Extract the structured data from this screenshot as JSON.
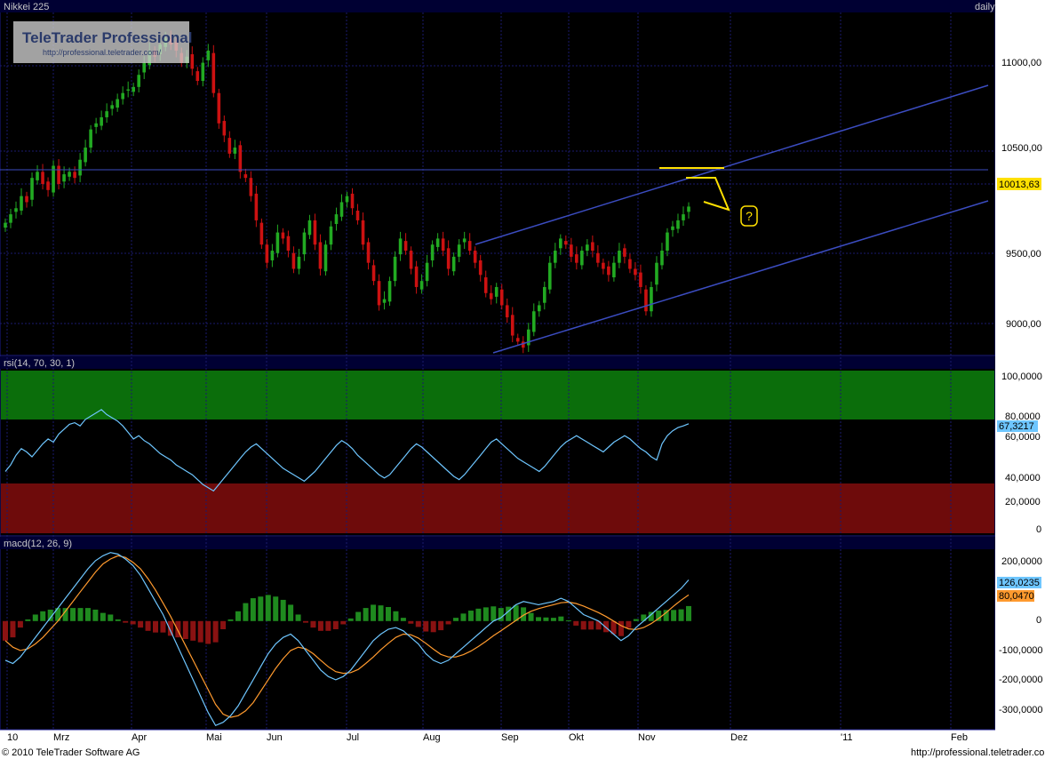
{
  "header": {
    "symbol": "Nikkei 225",
    "interval": "daily"
  },
  "watermark": {
    "brand": "TeleTrader Professional",
    "url": "http://professional.teletrader.com/"
  },
  "months": [
    "10",
    "Mrz",
    "Apr",
    "Mai",
    "Jun",
    "Jul",
    "Aug",
    "Sep",
    "Okt",
    "Nov",
    "Dez",
    "'11",
    "Feb"
  ],
  "footer": {
    "copyright": "© 2010 TeleTrader Software AG",
    "url": "http://professional.teletrader.com/"
  },
  "colors": {
    "background": "#000000",
    "pane_border": "#1a1a8c",
    "grid": "#1a1a6e",
    "candle_up": "#22aa22",
    "candle_down": "#cc1111",
    "channel": "#3b4cc0",
    "annotation": "#ffe000",
    "rsi_line": "#6ec6ff",
    "rsi_overbought": "#0b6e0b",
    "rsi_oversold": "#6e0b0b",
    "macd_line": "#6ec6ff",
    "macd_signal": "#ff9a2e",
    "hist_pos": "#1f8a1f",
    "hist_neg": "#8a1212"
  },
  "chart_data": [
    {
      "type": "candlestick",
      "title": "Nikkei 225",
      "ylim": [
        8800,
        11600
      ],
      "yticks": [
        "11000,00",
        "10500,00",
        "10013,63",
        "9500,00",
        "9000,00"
      ],
      "last_value": "10013,63",
      "x_months": [
        "10",
        "Mrz",
        "Apr",
        "Mai",
        "Jun",
        "Jul",
        "Aug",
        "Sep",
        "Okt",
        "Nov",
        "Dez",
        "'11",
        "Feb"
      ],
      "close": [
        9880,
        9950,
        10000,
        10100,
        10050,
        10250,
        10300,
        10200,
        10150,
        10350,
        10200,
        10280,
        10300,
        10250,
        10400,
        10500,
        10650,
        10700,
        10750,
        10800,
        10850,
        10900,
        10950,
        10980,
        11000,
        11100,
        11200,
        11300,
        11250,
        11350,
        11400,
        11350,
        11300,
        11200,
        11250,
        11150,
        11050,
        11200,
        11300,
        10950,
        10700,
        10600,
        10450,
        10500,
        10300,
        10250,
        10100,
        9900,
        9700,
        9550,
        9650,
        9800,
        9750,
        9650,
        9500,
        9600,
        9800,
        9900,
        9700,
        9500,
        9700,
        9850,
        9950,
        10050,
        10100,
        10000,
        9900,
        9700,
        9550,
        9400,
        9200,
        9250,
        9400,
        9600,
        9750,
        9650,
        9500,
        9350,
        9400,
        9550,
        9700,
        9750,
        9650,
        9500,
        9600,
        9700,
        9750,
        9650,
        9550,
        9450,
        9300,
        9250,
        9350,
        9200,
        9100,
        8950,
        8900,
        8850,
        9000,
        9150,
        9200,
        9350,
        9550,
        9650,
        9750,
        9700,
        9600,
        9550,
        9650,
        9700,
        9650,
        9550,
        9500,
        9450,
        9550,
        9650,
        9600,
        9500,
        9450,
        9350,
        9150,
        9350,
        9550,
        9650,
        9800,
        9850,
        9900,
        9950,
        10013.63
      ],
      "annotations": [
        "?"
      ]
    },
    {
      "type": "line",
      "title": "rsi(14, 70, 30, 1)",
      "ylim": [
        0,
        100
      ],
      "yticks": [
        "100,0000",
        "80,0000",
        "60,0000",
        "40,0000",
        "20,0000",
        "0"
      ],
      "overbought": 70,
      "oversold": 30,
      "last_value": "67,3217",
      "values": [
        38,
        42,
        48,
        52,
        50,
        47,
        51,
        55,
        58,
        56,
        61,
        64,
        67,
        68,
        66,
        70,
        72,
        74,
        76,
        73,
        71,
        69,
        66,
        62,
        58,
        60,
        57,
        55,
        52,
        49,
        47,
        45,
        42,
        40,
        38,
        36,
        33,
        30,
        28,
        26,
        30,
        34,
        38,
        42,
        46,
        50,
        53,
        55,
        52,
        49,
        46,
        43,
        40,
        38,
        36,
        34,
        32,
        35,
        38,
        42,
        46,
        50,
        54,
        57,
        55,
        52,
        48,
        45,
        42,
        39,
        36,
        34,
        36,
        40,
        44,
        48,
        52,
        55,
        53,
        50,
        47,
        44,
        41,
        38,
        35,
        33,
        36,
        40,
        44,
        48,
        52,
        56,
        58,
        55,
        52,
        49,
        46,
        44,
        42,
        40,
        38,
        41,
        45,
        49,
        53,
        56,
        58,
        60,
        58,
        56,
        54,
        52,
        50,
        53,
        56,
        58,
        60,
        58,
        55,
        52,
        50,
        47,
        45,
        55,
        60,
        63,
        65,
        66,
        67.3217
      ]
    },
    {
      "type": "line",
      "title": "macd(12, 26, 9)",
      "ylim": [
        -330,
        220
      ],
      "yticks": [
        "200,0000",
        "126,0235",
        "80,0470",
        "0",
        "-100,0000",
        "-200,0000",
        "-300,0000"
      ],
      "series": [
        {
          "name": "macd",
          "last_value": "126,0235"
        },
        {
          "name": "signal",
          "last_value": "80,0470"
        }
      ],
      "macd": [
        -120,
        -130,
        -110,
        -80,
        -50,
        -20,
        10,
        40,
        70,
        100,
        130,
        160,
        185,
        200,
        210,
        205,
        190,
        170,
        140,
        100,
        60,
        20,
        -30,
        -80,
        -130,
        -180,
        -230,
        -280,
        -320,
        -310,
        -290,
        -260,
        -220,
        -180,
        -140,
        -100,
        -70,
        -50,
        -40,
        -60,
        -90,
        -120,
        -150,
        -170,
        -180,
        -170,
        -150,
        -120,
        -90,
        -60,
        -40,
        -25,
        -20,
        -30,
        -50,
        -70,
        -100,
        -120,
        -130,
        -120,
        -100,
        -80,
        -60,
        -40,
        -20,
        0,
        10,
        30,
        50,
        60,
        55,
        50,
        55,
        60,
        70,
        60,
        40,
        20,
        10,
        0,
        -20,
        -40,
        -60,
        -45,
        -20,
        0,
        20,
        40,
        60,
        80,
        100,
        126.0235
      ],
      "signal": [
        -60,
        -80,
        -90,
        -85,
        -70,
        -50,
        -25,
        0,
        30,
        60,
        90,
        120,
        150,
        175,
        190,
        200,
        195,
        180,
        160,
        130,
        95,
        55,
        15,
        -30,
        -75,
        -120,
        -165,
        -210,
        -255,
        -285,
        -295,
        -290,
        -275,
        -250,
        -215,
        -180,
        -145,
        -115,
        -90,
        -80,
        -85,
        -100,
        -120,
        -140,
        -155,
        -160,
        -158,
        -148,
        -130,
        -110,
        -88,
        -68,
        -50,
        -40,
        -42,
        -52,
        -68,
        -86,
        -102,
        -110,
        -110,
        -103,
        -92,
        -78,
        -62,
        -45,
        -30,
        -14,
        2,
        18,
        30,
        38,
        44,
        50,
        56,
        58,
        54,
        46,
        36,
        26,
        14,
        0,
        -14,
        -24,
        -26,
        -20,
        -8,
        8,
        26,
        46,
        64,
        80.047
      ]
    }
  ]
}
